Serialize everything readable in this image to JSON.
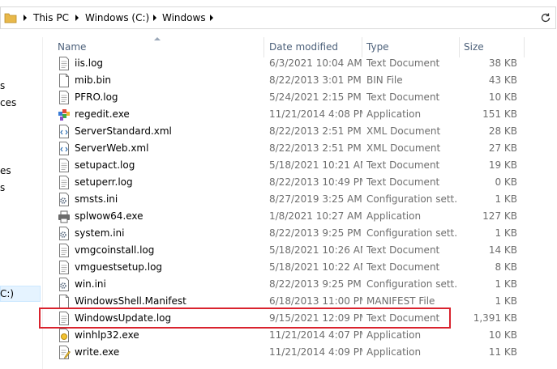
{
  "address_bar": {
    "crumbs": [
      "This PC",
      "Windows (C:)",
      "Windows"
    ]
  },
  "nav_fragments": [
    "s",
    "ces",
    "es",
    "s",
    "C:)"
  ],
  "columns": {
    "name": "Name",
    "date": "Date modified",
    "type": "Type",
    "size": "Size"
  },
  "files": [
    {
      "name": "iis.log",
      "date": "6/3/2021 10:04 AM",
      "type": "Text Document",
      "size": "38 KB",
      "icon": "text-file-icon"
    },
    {
      "name": "mib.bin",
      "date": "8/22/2013 3:01 PM",
      "type": "BIN File",
      "size": "43 KB",
      "icon": "blank-file-icon"
    },
    {
      "name": "PFRO.log",
      "date": "5/24/2021 2:15 PM",
      "type": "Text Document",
      "size": "10 KB",
      "icon": "text-file-icon"
    },
    {
      "name": "regedit.exe",
      "date": "11/21/2014 4:08 PM",
      "type": "Application",
      "size": "151 KB",
      "icon": "regedit-icon"
    },
    {
      "name": "ServerStandard.xml",
      "date": "8/22/2013 2:51 PM",
      "type": "XML Document",
      "size": "28 KB",
      "icon": "xml-file-icon"
    },
    {
      "name": "ServerWeb.xml",
      "date": "8/22/2013 2:51 PM",
      "type": "XML Document",
      "size": "27 KB",
      "icon": "xml-file-icon"
    },
    {
      "name": "setupact.log",
      "date": "5/18/2021 10:21 AM",
      "type": "Text Document",
      "size": "19 KB",
      "icon": "text-file-icon"
    },
    {
      "name": "setuperr.log",
      "date": "8/22/2013 10:49 PM",
      "type": "Text Document",
      "size": "0 KB",
      "icon": "text-file-icon"
    },
    {
      "name": "smsts.ini",
      "date": "8/27/2019 3:25 AM",
      "type": "Configuration sett...",
      "size": "1 KB",
      "icon": "config-file-icon"
    },
    {
      "name": "splwow64.exe",
      "date": "1/8/2021 10:27 AM",
      "type": "Application",
      "size": "127 KB",
      "icon": "printer-icon"
    },
    {
      "name": "system.ini",
      "date": "8/22/2013 9:25 PM",
      "type": "Configuration sett...",
      "size": "1 KB",
      "icon": "config-file-icon"
    },
    {
      "name": "vmgcoinstall.log",
      "date": "5/18/2021 10:26 AM",
      "type": "Text Document",
      "size": "14 KB",
      "icon": "text-file-icon"
    },
    {
      "name": "vmguestsetup.log",
      "date": "5/18/2021 10:22 AM",
      "type": "Text Document",
      "size": "8 KB",
      "icon": "text-file-icon"
    },
    {
      "name": "win.ini",
      "date": "8/22/2013 9:25 PM",
      "type": "Configuration sett...",
      "size": "1 KB",
      "icon": "config-file-icon"
    },
    {
      "name": "WindowsShell.Manifest",
      "date": "6/18/2013 11:00 PM",
      "type": "MANIFEST File",
      "size": "1 KB",
      "icon": "blank-file-icon"
    },
    {
      "name": "WindowsUpdate.log",
      "date": "9/15/2021 12:09 PM",
      "type": "Text Document",
      "size": "1,391 KB",
      "icon": "text-file-icon"
    },
    {
      "name": "winhlp32.exe",
      "date": "11/21/2014 4:07 PM",
      "type": "Application",
      "size": "10 KB",
      "icon": "help-app-icon"
    },
    {
      "name": "write.exe",
      "date": "11/21/2014 4:09 PM",
      "type": "Application",
      "size": "11 KB",
      "icon": "write-app-icon"
    }
  ],
  "colors": {
    "highlight": "#d9232e",
    "header_text": "#4c607a",
    "meta_text": "#6d6d6d"
  }
}
